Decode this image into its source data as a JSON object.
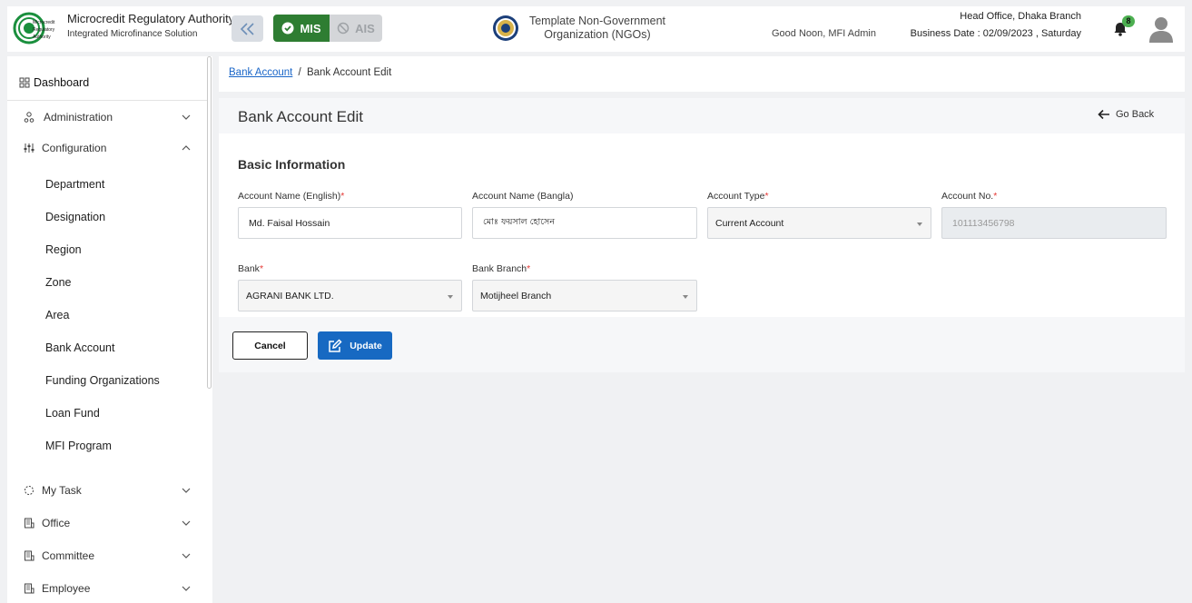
{
  "header": {
    "brand_title": "Microcredit Regulatory Authority",
    "brand_subtitle": "Integrated Microfinance Solution",
    "logo_text": [
      "Microcredit",
      "Regulatory",
      "Authority"
    ],
    "mis_label": "MIS",
    "ais_label": "AIS",
    "org_line1": "Template Non-Government",
    "org_line2": "Organization (NGOs)",
    "greeting": "Good Noon, MFI Admin",
    "branch": "Head Office, Dhaka Branch",
    "business_date": "Business Date : 02/09/2023 , Saturday",
    "notification_count": "8"
  },
  "sidebar": {
    "dashboard": "Dashboard",
    "items": [
      {
        "label": "Administration"
      },
      {
        "label": "Configuration"
      }
    ],
    "config_subitems": [
      "Department",
      "Designation",
      "Region",
      "Zone",
      "Area",
      "Bank Account",
      "Funding Organizations",
      "Loan Fund",
      "MFI Program"
    ],
    "lower_items": [
      {
        "label": "My Task"
      },
      {
        "label": "Office"
      },
      {
        "label": "Committee"
      },
      {
        "label": "Employee"
      }
    ]
  },
  "breadcrumb": {
    "parent": "Bank Account",
    "separator": "/",
    "current": "Bank Account Edit"
  },
  "page": {
    "title": "Bank Account Edit",
    "go_back": "Go Back",
    "section_title": "Basic Information"
  },
  "form": {
    "account_name_en": {
      "label": "Account Name (English)",
      "required": "*",
      "value": "Md. Faisal Hossain"
    },
    "account_name_bn": {
      "label": "Account Name (Bangla)",
      "value": "মোঃ ফয়সাল হোসেন"
    },
    "account_type": {
      "label": "Account Type",
      "required": "*",
      "value": "Current Account"
    },
    "account_no": {
      "label": "Account No.",
      "required": "*",
      "value": "101113456798"
    },
    "bank": {
      "label": "Bank",
      "required": "*",
      "value": "AGRANI BANK LTD."
    },
    "bank_branch": {
      "label": "Bank Branch",
      "required": "*",
      "value": "Motijheel Branch"
    }
  },
  "actions": {
    "cancel": "Cancel",
    "update": "Update"
  },
  "colors": {
    "primary": "#1769c2",
    "mis_green": "#2e7d32",
    "required_red": "#e53935",
    "badge_green": "#4caf50"
  }
}
